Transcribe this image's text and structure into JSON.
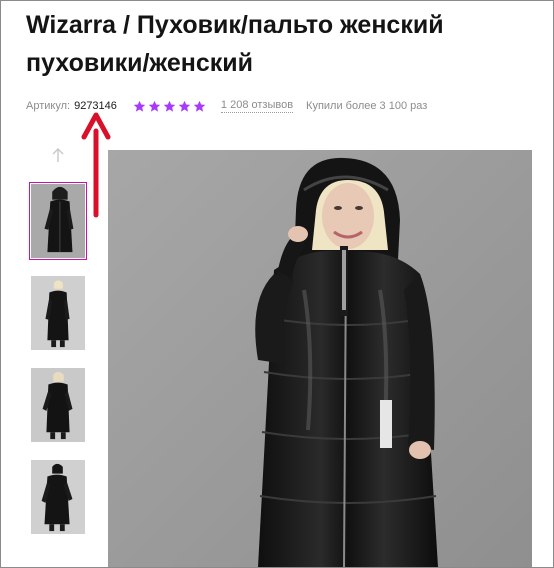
{
  "product": {
    "title": "Wizarra / Пуховик/пальто женский пуховики/женский",
    "article_label": "Артикул:",
    "article_value": "9273146",
    "rating_stars": 5,
    "reviews": "1 208 отзывов",
    "bought": "Купили более 3 100 раз"
  },
  "colors": {
    "star": "#a73afd",
    "active_thumb_border": "#cb11ab",
    "annotation_arrow": "#d9102a",
    "photo_background": "#9e9e9e"
  },
  "gallery": {
    "up_arrow_icon": "chevron-up-icon",
    "thumbnail_count": 4,
    "active_thumbnail": 1
  }
}
